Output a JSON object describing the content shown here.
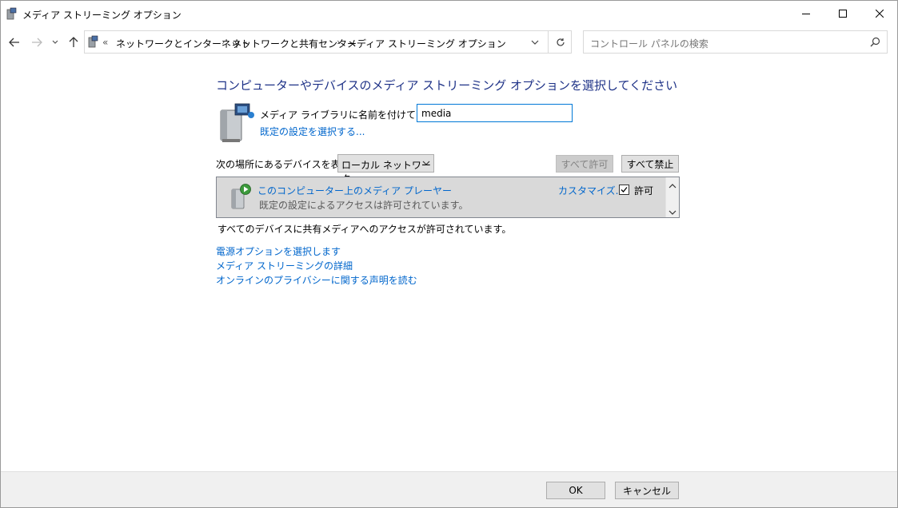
{
  "window": {
    "title": "メディア ストリーミング オプション",
    "icon": "media-streaming-icon",
    "controls": [
      "minimize-icon",
      "maximize-icon",
      "close-icon"
    ]
  },
  "address": {
    "overflow": "«",
    "crumbs": [
      "ネットワークとインターネット",
      "ネットワークと共有センター",
      "メディア ストリーミング オプション"
    ]
  },
  "search": {
    "placeholder": "コントロール パネルの検索"
  },
  "main": {
    "heading": "コンピューターやデバイスのメディア ストリーミング オプションを選択してください",
    "library_label": "メディア ライブラリに名前を付けてください:",
    "library_value": "media",
    "default_settings_link": "既定の設定を選択する...",
    "show_devices_label": "次の場所にあるデバイスを表示:",
    "location_selected": "ローカル ネットワーク",
    "allow_all": "すべて許可",
    "block_all": "すべて禁止",
    "device": {
      "name": "このコンピューター上のメディア プレーヤー",
      "status": "既定の設定によるアクセスは許可されています。",
      "customize": "カスタマイズ...",
      "allow_label": "許可",
      "allowed": true
    },
    "status_text": "すべてのデバイスに共有メディアへのアクセスが許可されています。",
    "links": [
      "電源オプションを選択します",
      "メディア ストリーミングの詳細",
      "オンラインのプライバシーに関する声明を読む"
    ]
  },
  "footer": {
    "ok": "OK",
    "cancel": "キャンセル"
  },
  "colors": {
    "heading": "#1e3287",
    "link": "#0066cc",
    "focus": "#0078d7"
  }
}
